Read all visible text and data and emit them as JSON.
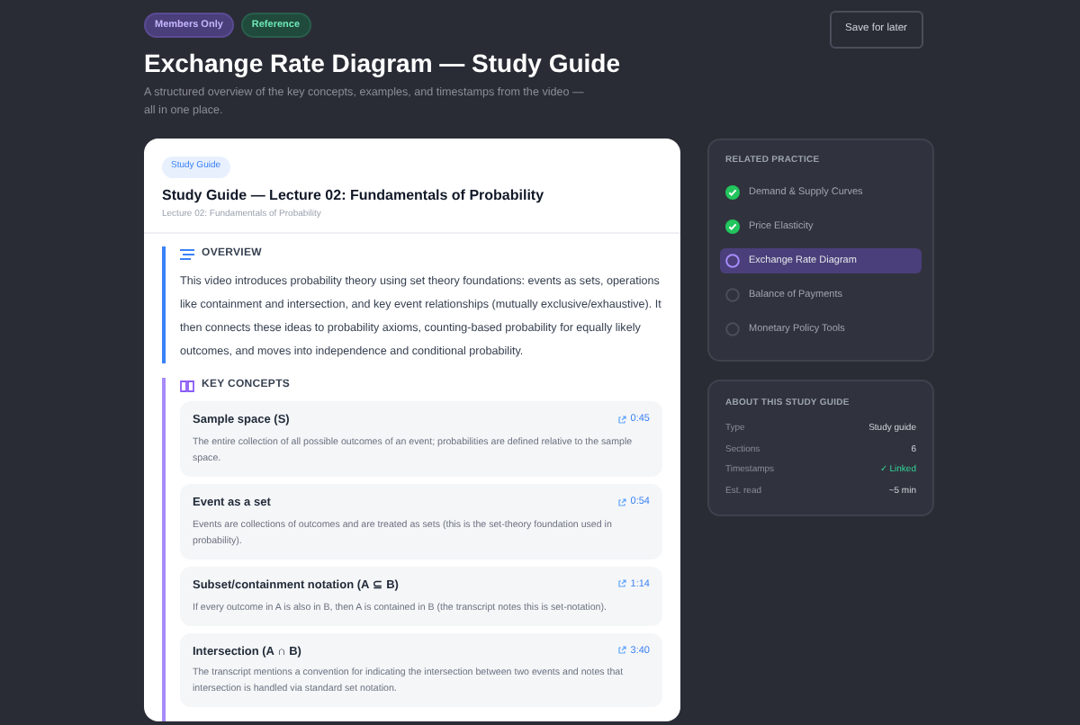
{
  "header": {
    "badges": [
      {
        "label": "Members Only",
        "kind": "members"
      },
      {
        "label": "Reference",
        "kind": "reference"
      }
    ],
    "title": "Exchange Rate Diagram — Study Guide",
    "subtitle": "A structured overview of the key concepts, examples, and timestamps from the video — all in one place.",
    "save_button": "Save for later"
  },
  "guide": {
    "badge": "Study Guide",
    "title": "Study Guide — Lecture 02: Fundamentals of Probability",
    "subtitle": "Lecture 02: Fundamentals of Probability",
    "overview": {
      "heading": "OVERVIEW",
      "text": "This video introduces probability theory using set theory foundations: events as sets, operations like containment and intersection, and key event relationships (mutually exclusive/exhaustive). It then connects these ideas to probability axioms, counting-based probability for equally likely outcomes, and moves into independence and conditional probability."
    },
    "key_concepts": {
      "heading": "KEY CONCEPTS",
      "items": [
        {
          "term": "Sample space (S)",
          "time": "0:45",
          "description": "The entire collection of all possible outcomes of an event; probabilities are defined relative to the sample space."
        },
        {
          "term": "Event as a set",
          "time": "0:54",
          "description": "Events are collections of outcomes and are treated as sets (this is the set-theory foundation used in probability)."
        },
        {
          "term": "Subset/containment notation (A ⊆ B)",
          "time": "1:14",
          "description": "If every outcome in A is also in B, then A is contained in B (the transcript notes this is set-notation)."
        },
        {
          "term": "Intersection (A ∩ B)",
          "time": "3:40",
          "description": "The transcript mentions a convention for indicating the intersection between two events and notes that intersection is handled via standard set notation."
        }
      ]
    }
  },
  "related_practice": {
    "heading": "RELATED PRACTICE",
    "items": [
      {
        "label": "Demand & Supply Curves",
        "done": true,
        "selected": false
      },
      {
        "label": "Price Elasticity",
        "done": true,
        "selected": false
      },
      {
        "label": "Exchange Rate Diagram",
        "done": false,
        "selected": true
      },
      {
        "label": "Balance of Payments",
        "done": false,
        "selected": false
      },
      {
        "label": "Monetary Policy Tools",
        "done": false,
        "selected": false
      }
    ]
  },
  "about": {
    "heading": "ABOUT THIS STUDY GUIDE",
    "rows": [
      {
        "label": "Type",
        "value": "Study guide",
        "kind": "plain"
      },
      {
        "label": "Sections",
        "value": "6",
        "kind": "plain"
      },
      {
        "label": "Timestamps",
        "value": "✓ Linked",
        "kind": "positive"
      },
      {
        "label": "Est. read",
        "value": "~5 min",
        "kind": "plain"
      }
    ]
  }
}
